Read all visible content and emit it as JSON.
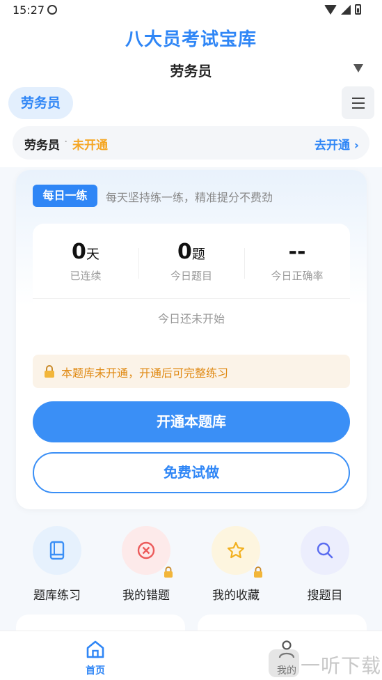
{
  "status_bar": {
    "time": "15:27"
  },
  "app": {
    "title": "八大员考试宝库"
  },
  "subject": {
    "selected": "劳务员"
  },
  "tabs": [
    {
      "label": "劳务员"
    }
  ],
  "status_card": {
    "name": "劳务员",
    "separator": "·",
    "state": "未开通",
    "action": "去开通 ›"
  },
  "daily": {
    "badge": "每日一练",
    "desc": "每天坚持练一练，精准提分不费劲",
    "stats": [
      {
        "value": "0",
        "unit": "天",
        "label": "已连续"
      },
      {
        "value": "0",
        "unit": "题",
        "label": "今日题目"
      },
      {
        "value": "--",
        "unit": "",
        "label": "今日正确率"
      }
    ],
    "not_started": "今日还未开始",
    "lock_notice": "本题库未开通，开通后可完整练习",
    "primary_button": "开通本题库",
    "secondary_button": "免费试做"
  },
  "features": [
    {
      "label": "题库练习",
      "icon": "book-icon",
      "locked": false,
      "color": "#3a8ff6",
      "bg": "#e6f1fd"
    },
    {
      "label": "我的错题",
      "icon": "error-circle-icon",
      "locked": true,
      "color": "#ec5b5b",
      "bg": "#fdeaea"
    },
    {
      "label": "我的收藏",
      "icon": "star-icon",
      "locked": true,
      "color": "#f2b01e",
      "bg": "#fdf5df"
    },
    {
      "label": "搜题目",
      "icon": "search-icon",
      "locked": false,
      "color": "#5a6cf0",
      "bg": "#eceefd"
    }
  ],
  "nav": {
    "home": "首页",
    "me": "我的"
  },
  "watermark": {
    "text": "一听下载"
  },
  "colors": {
    "accent": "#2f86f6",
    "warning": "#f5a623"
  }
}
